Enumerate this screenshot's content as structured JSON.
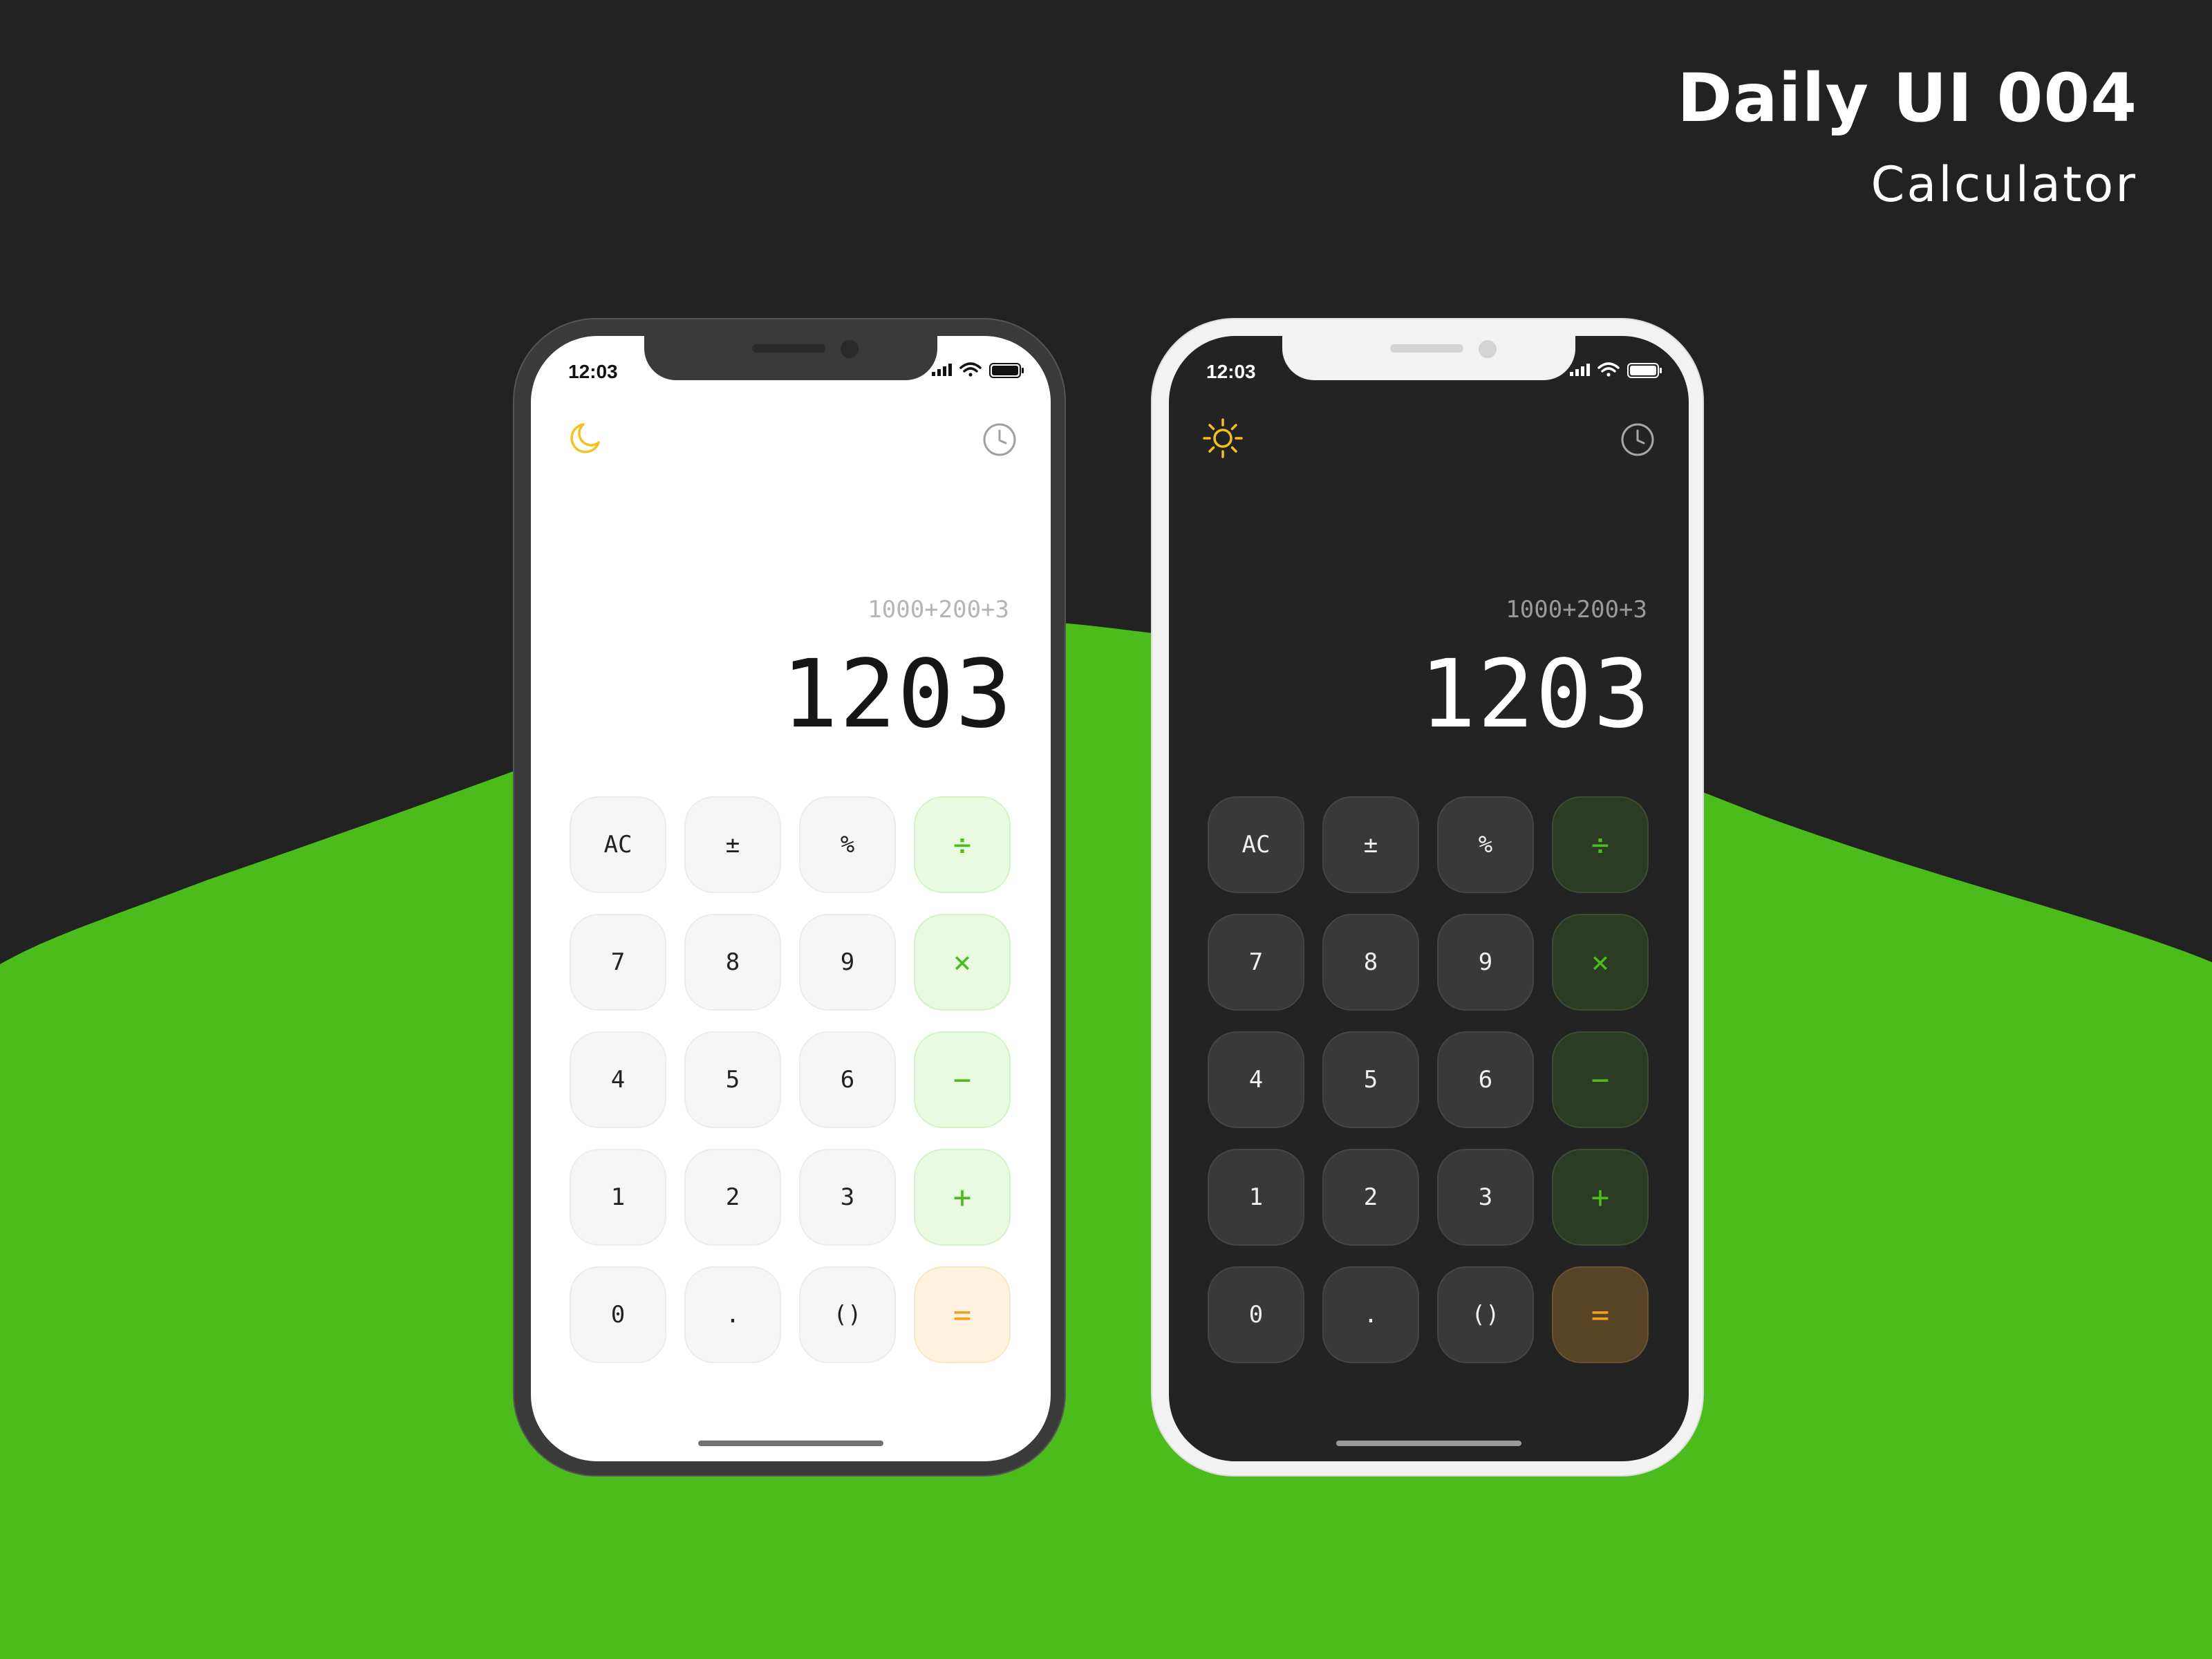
{
  "header": {
    "title": "Daily UI 004",
    "subtitle": "Calculator"
  },
  "colors": {
    "background": "#222222",
    "accent_green": "#4cbb1c",
    "key_operator_text": "#4fba1e",
    "key_equals_text": "#f3a31a"
  },
  "phones": [
    {
      "theme": "light",
      "status_time": "12:03",
      "mode_icon": "moon-icon",
      "history_icon": "clock-icon",
      "expression": "1000+200+3",
      "result": "1203",
      "keys": [
        [
          "AC",
          "±",
          "%",
          "÷"
        ],
        [
          "7",
          "8",
          "9",
          "×"
        ],
        [
          "4",
          "5",
          "6",
          "−"
        ],
        [
          "1",
          "2",
          "3",
          "+"
        ],
        [
          "0",
          ".",
          "()",
          "="
        ]
      ]
    },
    {
      "theme": "dark",
      "status_time": "12:03",
      "mode_icon": "sun-icon",
      "history_icon": "clock-icon",
      "expression": "1000+200+3",
      "result": "1203",
      "keys": [
        [
          "AC",
          "±",
          "%",
          "÷"
        ],
        [
          "7",
          "8",
          "9",
          "×"
        ],
        [
          "4",
          "5",
          "6",
          "−"
        ],
        [
          "1",
          "2",
          "3",
          "+"
        ],
        [
          "0",
          ".",
          "()",
          "="
        ]
      ]
    }
  ]
}
